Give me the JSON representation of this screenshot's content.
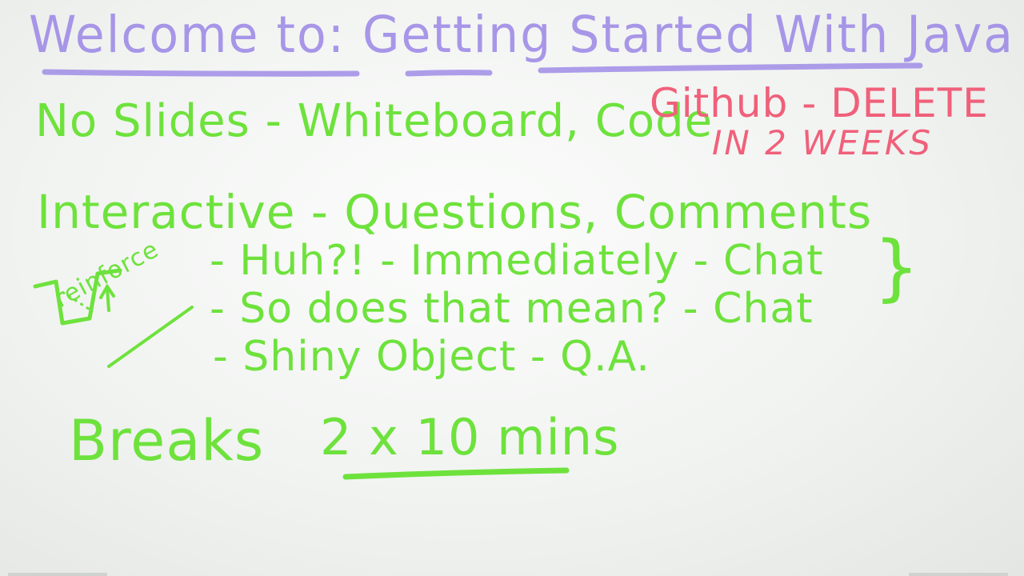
{
  "whiteboard": {
    "title": "Welcome to: Getting Started With Java",
    "line1": "No Slides - Whiteboard, Code",
    "github_note": [
      "Github - DELETE",
      "IN 2 WEEKS"
    ],
    "line2": "Interactive - Questions, Comments",
    "items": [
      "- Huh?! - Immediately - Chat",
      "- So does that mean? - Chat",
      "- Shiny Object - Q.A."
    ],
    "side_note": "reinforce",
    "breaks_label": "Breaks",
    "breaks_value": "2 x 10 mins"
  },
  "colors": {
    "title_ink": "#9b86e6",
    "body_ink": "#6ee23c",
    "note_ink": "#f0607a",
    "board": "#f4f6f4"
  }
}
